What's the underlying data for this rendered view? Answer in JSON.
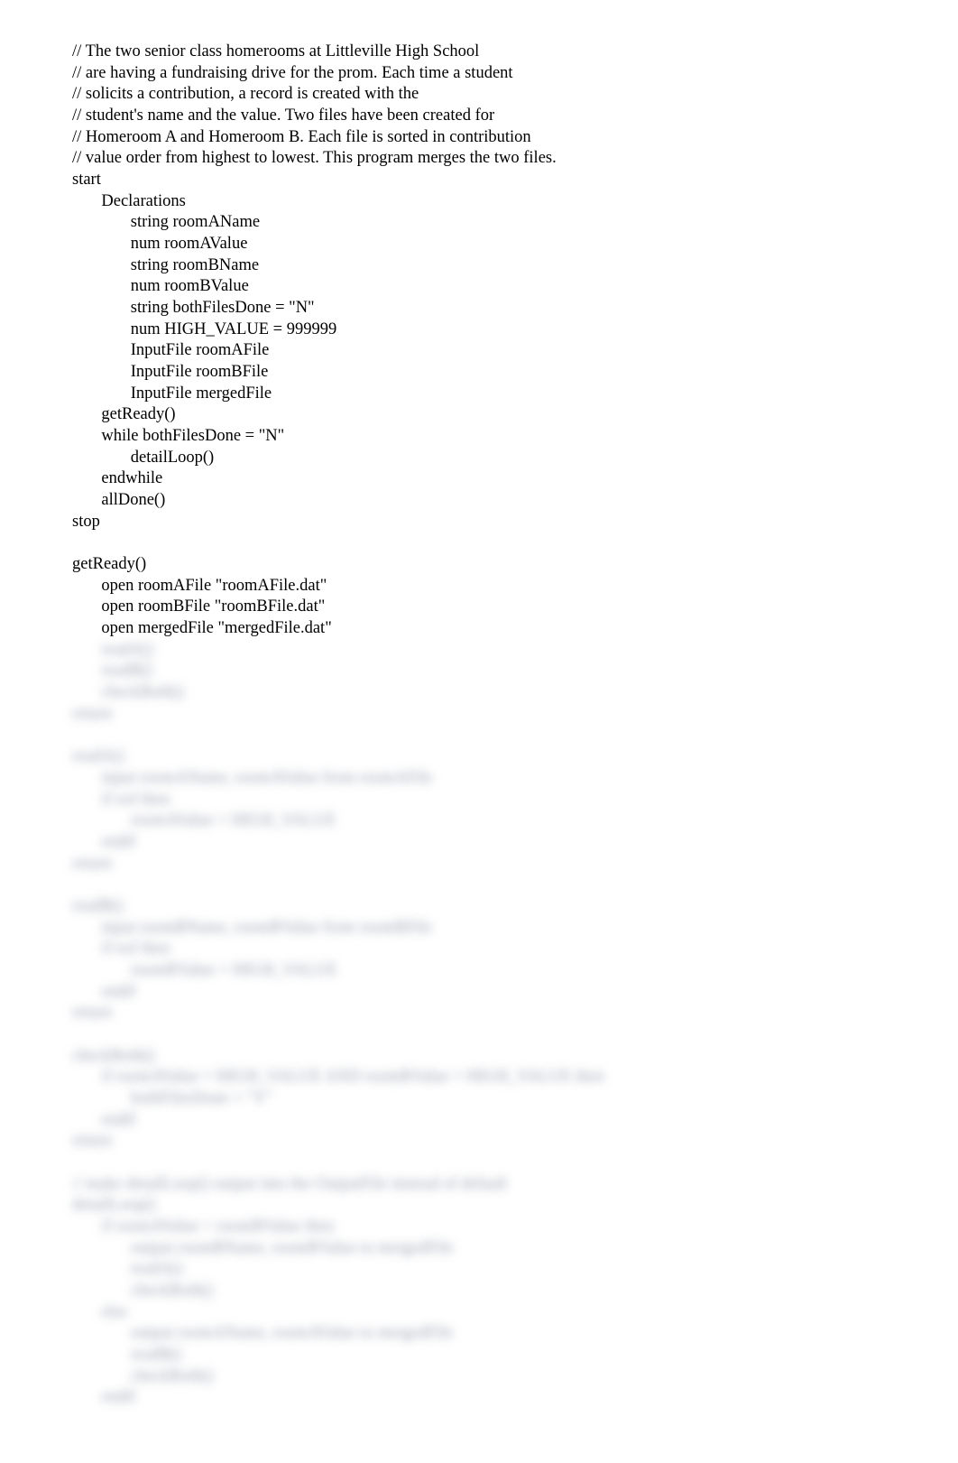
{
  "code": {
    "clear": "// The two senior class homerooms at Littleville High School\n// are having a fundraising drive for the prom. Each time a student\n// solicits a contribution, a record is created with the\n// student's name and the value. Two files have been created for\n// Homeroom A and Homeroom B. Each file is sorted in contribution\n// value order from highest to lowest. This program merges the two files.\nstart\n       Declarations\n              string roomAName\n              num roomAValue\n              string roomBName\n              num roomBValue\n              string bothFilesDone = \"N\"\n              num HIGH_VALUE = 999999\n              InputFile roomAFile\n              InputFile roomBFile\n              InputFile mergedFile\n       getReady()\n       while bothFilesDone = \"N\"\n              detailLoop()\n       endwhile\n       allDone()\nstop\n\ngetReady()\n       open roomAFile \"roomAFile.dat\"\n       open roomBFile \"roomBFile.dat\"\n       open mergedFile \"mergedFile.dat\"",
    "blur": "       readA()\n       readB()\n       checkBoth()\nreturn\n\nreadA()\n       input roomAName, roomAValue from roomAFile\n       if eof then\n              roomAValue = HIGH_VALUE\n       endif\nreturn\n\nreadB()\n       input roomBName, roomBValue from roomBFile\n       if eof then\n              roomBValue = HIGH_VALUE\n       endif\nreturn\n\ncheckBoth()\n       if roomAValue = HIGH_VALUE AND roomBValue = HIGH_VALUE then\n              bothFilesDone = \"Y\"\n       endif\nreturn\n\n// make detailLoop() output into the OutputFile instead of default\ndetailLoop()\n       if roomAValue > roomBValue then\n              output roomBName, roomBValue to mergedFile\n              readA()\n              checkBoth()\n       else\n              output roomAName, roomAValue to mergedFile\n              readB()\n              checkBoth()\n       endif"
  }
}
